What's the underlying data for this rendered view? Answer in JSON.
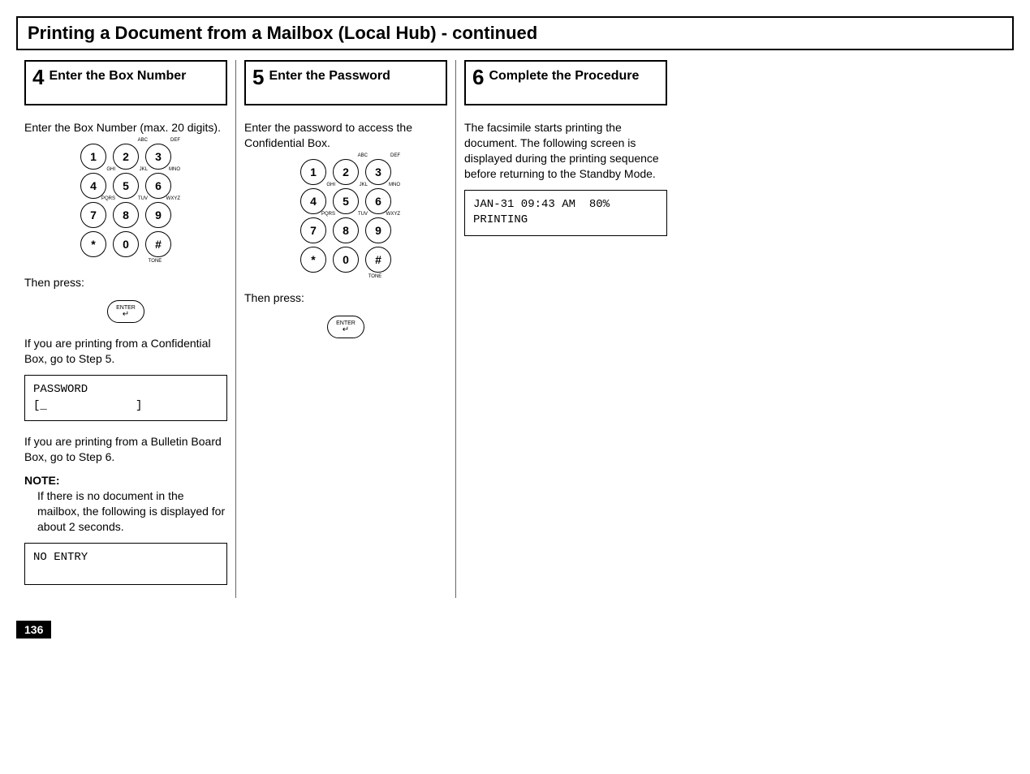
{
  "page_title": "Printing a Document from a Mailbox (Local Hub) - continued",
  "step4": {
    "num": "4",
    "title": "Enter the Box Number",
    "intro": "Enter the Box Number (max. 20 digits).",
    "then_press": "Then press:",
    "enter_label": "ENTER",
    "confi_text": "If you are printing from a Confidential Box, go to Step 5.",
    "lcd_password_l1": "PASSWORD",
    "lcd_password_l2": "[_             ]",
    "bulletin_text": "If you are printing from a Bulletin Board Box, go to Step 6.",
    "note_title": "NOTE:",
    "note_body": "If there is no document in the mailbox, the following is displayed for about 2 seconds.",
    "lcd_noentry": "NO ENTRY"
  },
  "step5": {
    "num": "5",
    "title": "Enter the Password",
    "intro": "Enter the password to access the Confidential Box.",
    "then_press": "Then press:",
    "enter_label": "ENTER"
  },
  "step6": {
    "num": "6",
    "title": "Complete the Procedure",
    "intro": "The facsimile starts printing the document. The following screen is displayed during the printing sequence before returning to the Standby Mode.",
    "lcd_l1": "JAN-31 09:43 AM  80%",
    "lcd_l2": "PRINTING"
  },
  "keypad": {
    "k1": "1",
    "k2": "2",
    "k3": "3",
    "k4": "4",
    "k5": "5",
    "k6": "6",
    "k7": "7",
    "k8": "8",
    "k9": "9",
    "kstar": "*",
    "k0": "0",
    "khash": "#",
    "abc": "ABC",
    "def": "DEF",
    "ghi": "GHI",
    "jkl": "JKL",
    "mno": "MNO",
    "pqrs": "PQRS",
    "tuv": "TUV",
    "wxyz": "WXYZ",
    "tone": "TONE"
  },
  "page_number": "136"
}
